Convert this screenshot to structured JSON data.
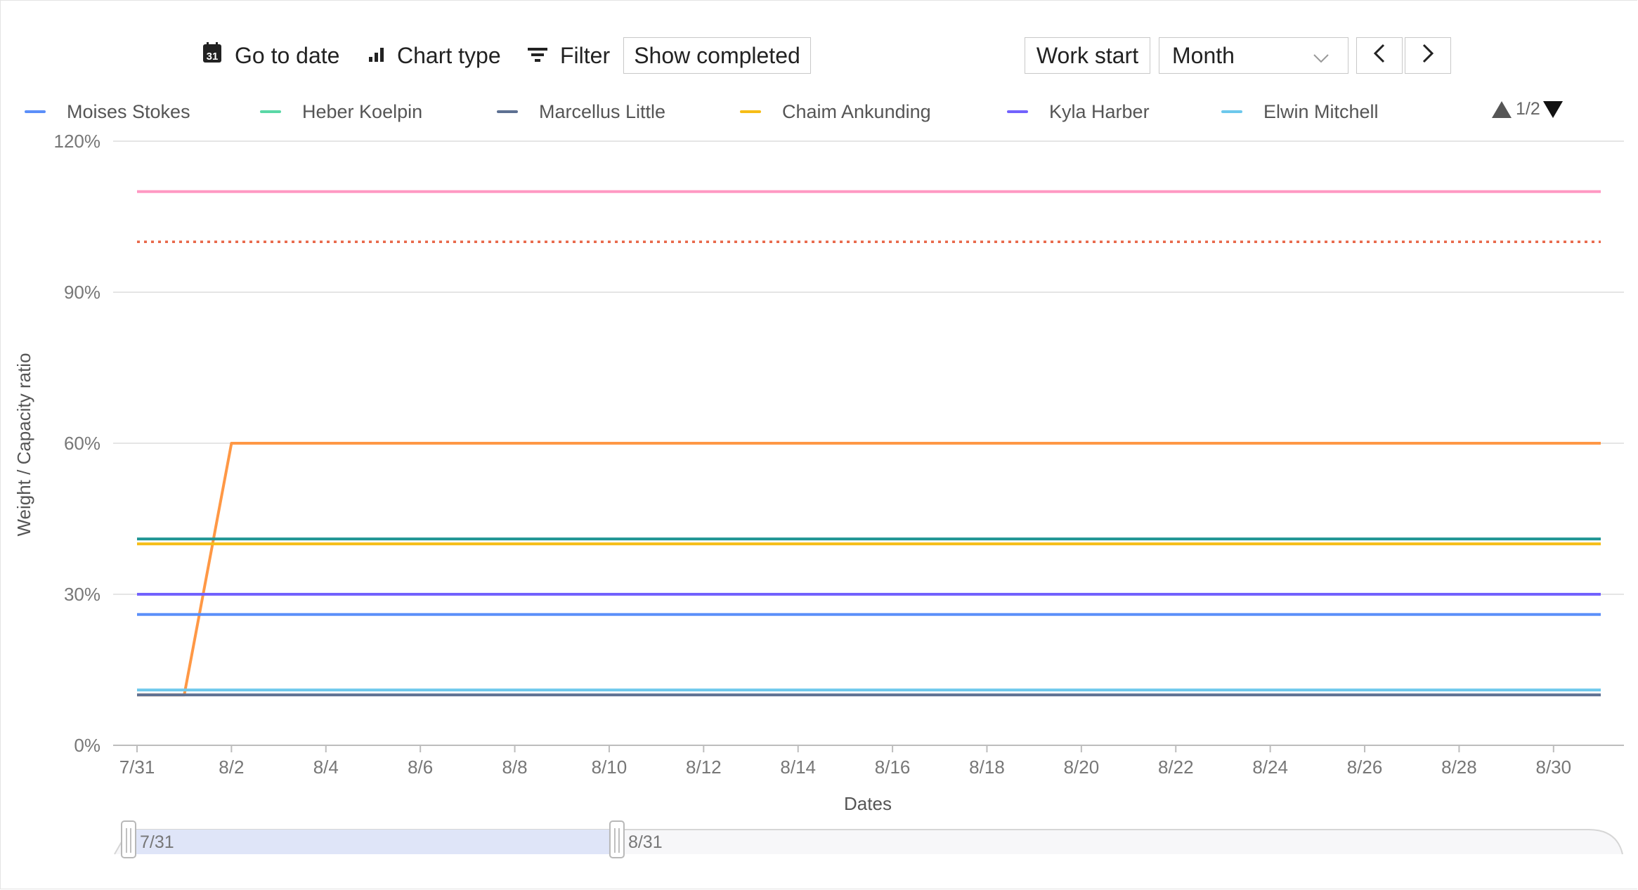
{
  "toolbar": {
    "go_to_date": "Go to date",
    "chart_type": "Chart type",
    "filter": "Filter",
    "show_completed": "Show completed",
    "work_start": "Work start",
    "period": "Month",
    "calendar_icon_day": "31"
  },
  "legend": {
    "items": [
      {
        "name": "Moises Stokes",
        "color": "#5b8ff9"
      },
      {
        "name": "Heber Koelpin",
        "color": "#5ad8a6"
      },
      {
        "name": "Marcellus Little",
        "color": "#5d7092"
      },
      {
        "name": "Chaim Ankunding",
        "color": "#f6bd16"
      },
      {
        "name": "Kyla Harber",
        "color": "#7262fd"
      },
      {
        "name": "Elwin Mitchell",
        "color": "#6dc8ec"
      }
    ],
    "page": "1/2"
  },
  "slider": {
    "start_label": "7/31",
    "end_label": "8/31",
    "range_fraction": [
      0.0,
      0.33
    ]
  },
  "chart_data": {
    "type": "line",
    "xlabel": "Dates",
    "ylabel": "Weight / Capacity ratio",
    "x": [
      "7/31",
      "8/1",
      "8/2",
      "8/3",
      "8/4",
      "8/5",
      "8/6",
      "8/7",
      "8/8",
      "8/9",
      "8/10",
      "8/11",
      "8/12",
      "8/13",
      "8/14",
      "8/15",
      "8/16",
      "8/17",
      "8/18",
      "8/19",
      "8/20",
      "8/21",
      "8/22",
      "8/23",
      "8/24",
      "8/25",
      "8/26",
      "8/27",
      "8/28",
      "8/29",
      "8/30",
      "8/31"
    ],
    "x_tick_labels": [
      "7/31",
      "8/2",
      "8/4",
      "8/6",
      "8/8",
      "8/10",
      "8/12",
      "8/14",
      "8/16",
      "8/18",
      "8/20",
      "8/22",
      "8/24",
      "8/26",
      "8/28",
      "8/30"
    ],
    "y_ticks": [
      0,
      30,
      60,
      90,
      120
    ],
    "y_tick_labels": [
      "0%",
      "30%",
      "60%",
      "90%",
      "120%"
    ],
    "ylim": [
      0,
      120
    ],
    "grid": true,
    "legend_position": "top",
    "series": [
      {
        "color": "#ff99c3",
        "constant": 110
      },
      {
        "color": "#e8684a",
        "constant": 100,
        "dashed": true
      },
      {
        "color": "#ff9845",
        "values": [
          10,
          10,
          60,
          60,
          60,
          60,
          60,
          60,
          60,
          60,
          60,
          60,
          60,
          60,
          60,
          60,
          60,
          60,
          60,
          60,
          60,
          60,
          60,
          60,
          60,
          60,
          60,
          60,
          60,
          60,
          60,
          60
        ]
      },
      {
        "color": "#1e9493",
        "constant": 41
      },
      {
        "color": "#f6bd16",
        "constant": 40
      },
      {
        "color": "#7262fd",
        "constant": 30
      },
      {
        "color": "#5b8ff9",
        "constant": 26
      },
      {
        "color": "#6dc8ec",
        "constant": 11
      },
      {
        "color": "#5d7092",
        "constant": 10
      }
    ]
  }
}
